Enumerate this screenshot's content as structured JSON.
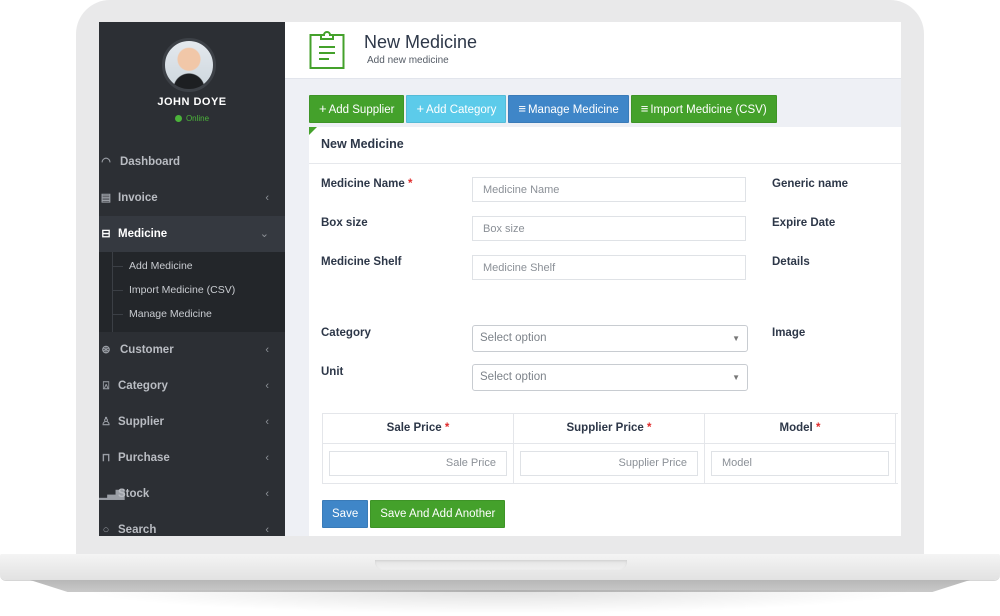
{
  "user": {
    "name": "JOHN DOYE",
    "status": "Online",
    "status_color": "#4bb33a"
  },
  "sidebar": {
    "items": [
      {
        "label": "Dashboard",
        "icon": "dashboard-icon",
        "has_chevron": false
      },
      {
        "label": "Invoice",
        "icon": "invoice-icon",
        "chevron": "‹"
      },
      {
        "label": "Medicine",
        "icon": "briefcase-icon",
        "chevron": "⌄",
        "active": true
      },
      {
        "label": "Customer",
        "icon": "handshake-icon",
        "chevron": "‹"
      },
      {
        "label": "Category",
        "icon": "tag-icon",
        "chevron": "‹"
      },
      {
        "label": "Supplier",
        "icon": "user-icon",
        "chevron": "‹"
      },
      {
        "label": "Purchase",
        "icon": "cart-icon",
        "chevron": "‹"
      },
      {
        "label": "Stock",
        "icon": "bar-chart-icon",
        "chevron": "‹"
      },
      {
        "label": "Search",
        "icon": "search-icon",
        "chevron": "‹"
      }
    ],
    "submenu": [
      {
        "label": "Add Medicine"
      },
      {
        "label": "Import Medicine (CSV)"
      },
      {
        "label": "Manage Medicine"
      }
    ]
  },
  "header": {
    "title": "New Medicine",
    "subtitle": "Add new medicine",
    "icon": "clipboard-icon",
    "accent": "#44a12b"
  },
  "toolbar": {
    "add_supplier": "Add Supplier",
    "add_category": "Add Category",
    "manage_medicine": "Manage Medicine",
    "import_medicine": "Import Medicine (CSV)",
    "plus_glyph": "+",
    "list_glyph": "≡"
  },
  "form": {
    "title": "New Medicine",
    "medicine_name_label": "Medicine Name",
    "medicine_name_placeholder": "Medicine Name",
    "box_size_label": "Box size",
    "box_size_placeholder": "Box size",
    "shelf_label": "Medicine Shelf",
    "shelf_placeholder": "Medicine  Shelf",
    "category_label": "Category",
    "category_value": "Select option",
    "unit_label": "Unit",
    "unit_value": "Select option",
    "generic_name_label": "Generic name",
    "expire_date_label": "Expire Date",
    "details_label": "Details",
    "image_label": "Image",
    "required_mark": "*"
  },
  "price_table": {
    "columns": [
      {
        "header": "Sale Price",
        "placeholder": "Sale Price",
        "align": "right"
      },
      {
        "header": "Supplier Price",
        "placeholder": "Supplier Price",
        "align": "right"
      },
      {
        "header": "Model",
        "placeholder": "Model",
        "align": "left"
      }
    ]
  },
  "actions": {
    "save": "Save",
    "save_add_another": "Save And Add Another"
  },
  "colors": {
    "green": "#44a12b",
    "cyan": "#5ccbea",
    "blue": "#3f86c8",
    "sidebar_bg": "#2c2f34",
    "required": "#e02b2b"
  }
}
